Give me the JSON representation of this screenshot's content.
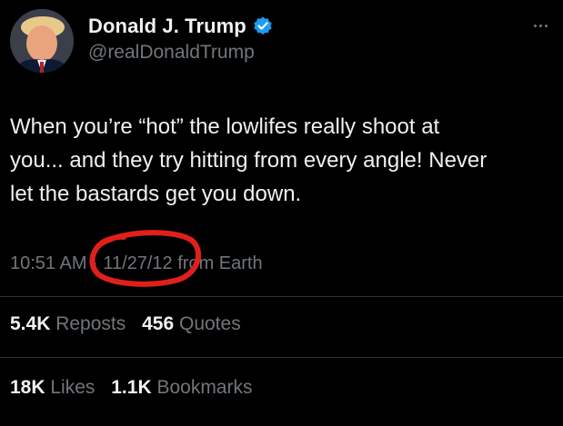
{
  "author": {
    "display_name": "Donald J. Trump",
    "handle": "@realDonaldTrump",
    "verified": true
  },
  "tweet": {
    "text": "When you’re “hot” the lowlifes really shoot at\nyou... and they try hitting from every angle! Never\nlet the bastards get you down."
  },
  "meta": {
    "time": "10:51 AM",
    "separator": "·",
    "date": "11/27/12",
    "source": "from Earth"
  },
  "stats_row1": [
    {
      "count": "5.4K",
      "label": "Reposts"
    },
    {
      "count": "456",
      "label": "Quotes"
    }
  ],
  "stats_row2": [
    {
      "count": "18K",
      "label": "Likes"
    },
    {
      "count": "1.1K",
      "label": "Bookmarks"
    }
  ],
  "colors": {
    "background": "#000000",
    "text": "#e7e9ea",
    "muted": "#71767b",
    "verified": "#1d9bf0",
    "annotation": "#e0201b"
  },
  "icons": {
    "verified": "verified-badge-icon",
    "more": "more-options-icon"
  }
}
